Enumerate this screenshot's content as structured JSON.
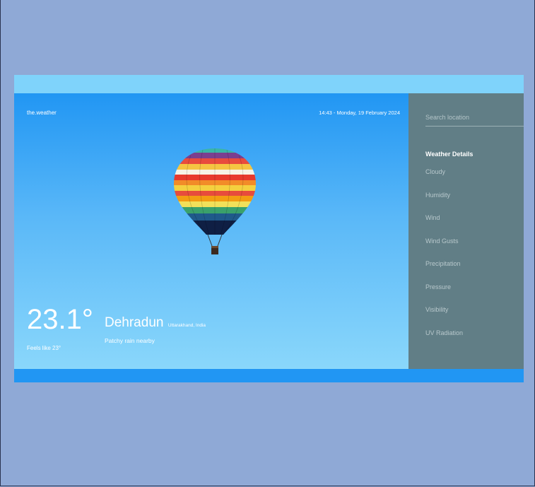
{
  "header": {
    "brand": "the.weather",
    "datetime": "14:43 - Monday, 19 February 2024"
  },
  "current": {
    "temperature": "23.1°",
    "feels_like": "Feels like 23°",
    "city": "Dehradun",
    "region": "Uttarakhand, India",
    "condition": "Patchy rain nearby"
  },
  "sidebar": {
    "search_placeholder": "Search location",
    "details_title": "Weather Details",
    "items": [
      {
        "label": "Cloudy"
      },
      {
        "label": "Humidity"
      },
      {
        "label": "Wind"
      },
      {
        "label": "Wind Gusts"
      },
      {
        "label": "Precipitation"
      },
      {
        "label": "Pressure"
      },
      {
        "label": "Visibility"
      },
      {
        "label": "UV Radiation"
      }
    ]
  },
  "colors": {
    "page_bg": "#8fa9d6",
    "topbar": "#7fd3fb",
    "main_gradient_top": "#2196f3",
    "main_gradient_bottom": "#8ad7fb",
    "sidebar_bg": "#617e86"
  },
  "icons": {
    "hero_image": "hot-air-balloon"
  }
}
